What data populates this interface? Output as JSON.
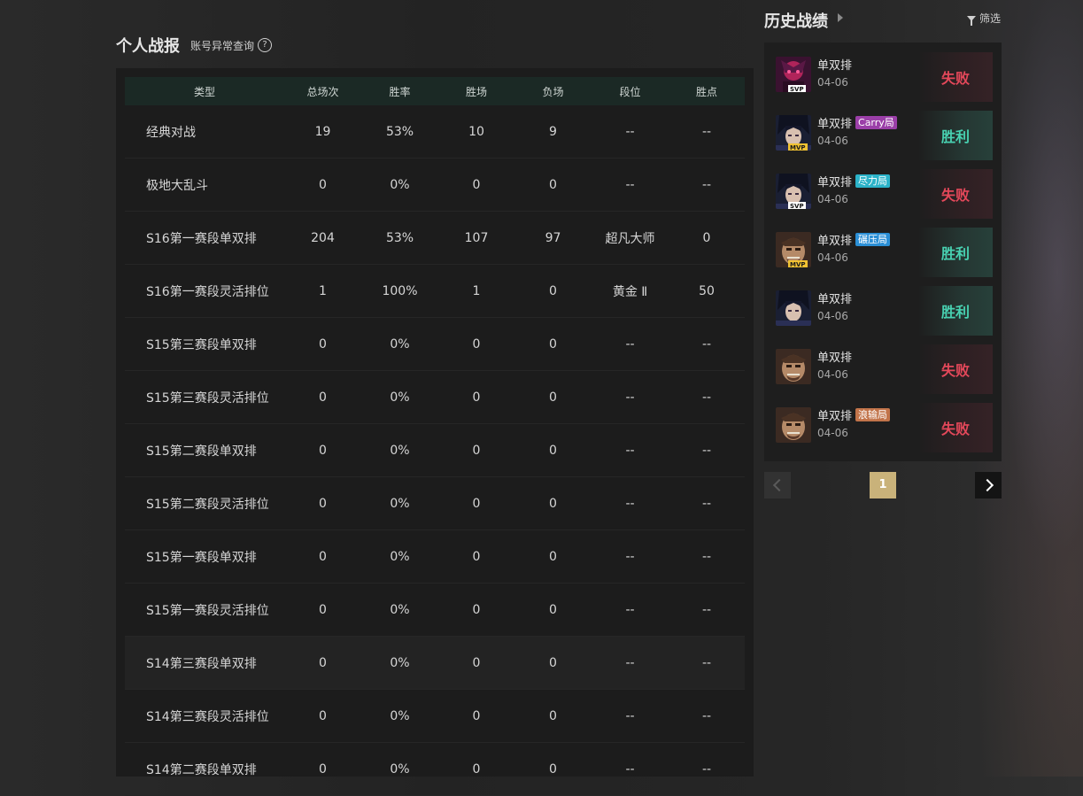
{
  "stats": {
    "title": "个人战报",
    "anomaly_link": "账号异常查询",
    "help_symbol": "?",
    "columns": [
      "类型",
      "总场次",
      "胜率",
      "胜场",
      "负场",
      "段位",
      "胜点"
    ],
    "rows": [
      [
        "经典对战",
        "19",
        "53%",
        "10",
        "9",
        "--",
        "--"
      ],
      [
        "极地大乱斗",
        "0",
        "0%",
        "0",
        "0",
        "--",
        "--"
      ],
      [
        "S16第一赛段单双排",
        "204",
        "53%",
        "107",
        "97",
        "超凡大师",
        "0"
      ],
      [
        "S16第一赛段灵活排位",
        "1",
        "100%",
        "1",
        "0",
        "黄金 Ⅱ",
        "50"
      ],
      [
        "S15第三赛段单双排",
        "0",
        "0%",
        "0",
        "0",
        "--",
        "--"
      ],
      [
        "S15第三赛段灵活排位",
        "0",
        "0%",
        "0",
        "0",
        "--",
        "--"
      ],
      [
        "S15第二赛段单双排",
        "0",
        "0%",
        "0",
        "0",
        "--",
        "--"
      ],
      [
        "S15第二赛段灵活排位",
        "0",
        "0%",
        "0",
        "0",
        "--",
        "--"
      ],
      [
        "S15第一赛段单双排",
        "0",
        "0%",
        "0",
        "0",
        "--",
        "--"
      ],
      [
        "S15第一赛段灵活排位",
        "0",
        "0%",
        "0",
        "0",
        "--",
        "--"
      ],
      [
        "S14第三赛段单双排",
        "0",
        "0%",
        "0",
        "0",
        "--",
        "--"
      ],
      [
        "S14第三赛段灵活排位",
        "0",
        "0%",
        "0",
        "0",
        "--",
        "--"
      ],
      [
        "S14第二赛段单双排",
        "0",
        "0%",
        "0",
        "0",
        "--",
        "--"
      ]
    ]
  },
  "history": {
    "title": "历史战绩",
    "filter_label": "筛选",
    "matches": [
      {
        "mode": "单双排",
        "tag": "",
        "tag_color": "",
        "date": "04-06",
        "result": "失败",
        "outcome": "lose",
        "badge": "SVP",
        "portrait": "purple"
      },
      {
        "mode": "单双排",
        "tag": "Carry局",
        "tag_color": "#9b3fa8",
        "date": "04-06",
        "result": "胜利",
        "outcome": "win",
        "badge": "MVP",
        "portrait": "dark"
      },
      {
        "mode": "单双排",
        "tag": "尽力局",
        "tag_color": "#2bb3c9",
        "date": "04-06",
        "result": "失败",
        "outcome": "lose",
        "badge": "SVP",
        "portrait": "dark"
      },
      {
        "mode": "单双排",
        "tag": "碾压局",
        "tag_color": "#2b8fd6",
        "date": "04-06",
        "result": "胜利",
        "outcome": "win",
        "badge": "MVP",
        "portrait": "tan"
      },
      {
        "mode": "单双排",
        "tag": "",
        "tag_color": "",
        "date": "04-06",
        "result": "胜利",
        "outcome": "win",
        "badge": "",
        "portrait": "dark"
      },
      {
        "mode": "单双排",
        "tag": "",
        "tag_color": "",
        "date": "04-06",
        "result": "失败",
        "outcome": "lose",
        "badge": "",
        "portrait": "tan"
      },
      {
        "mode": "单双排",
        "tag": "浪输局",
        "tag_color": "#c2744a",
        "date": "04-06",
        "result": "失败",
        "outcome": "lose",
        "badge": "",
        "portrait": "tan"
      }
    ],
    "pagination": {
      "current": "1"
    }
  },
  "colors": {
    "win": "#48d1b1",
    "lose": "#e4485a",
    "page_active": "#c9b27a",
    "mvp": "#f1c232"
  },
  "icons": {
    "help": "help-circle-icon",
    "expand": "caret-right-icon",
    "filter": "funnel-icon",
    "prev": "chevron-left-icon",
    "next": "chevron-right-icon"
  }
}
